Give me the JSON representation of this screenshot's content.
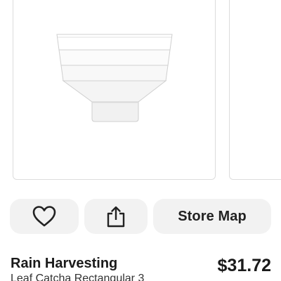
{
  "carousel": {
    "image_alt": "product-image"
  },
  "actions": {
    "favorite_icon": "heart-icon",
    "share_icon": "share-icon",
    "store_map_label": "Store Map"
  },
  "product": {
    "brand": "Rain Harvesting",
    "name": "Leaf Catcha Rectangular 3",
    "price": "$31.72"
  },
  "colors": {
    "button_bg": "#f2f2f2",
    "text_primary": "#1a1a1a",
    "card_border": "#dcdcdc"
  }
}
